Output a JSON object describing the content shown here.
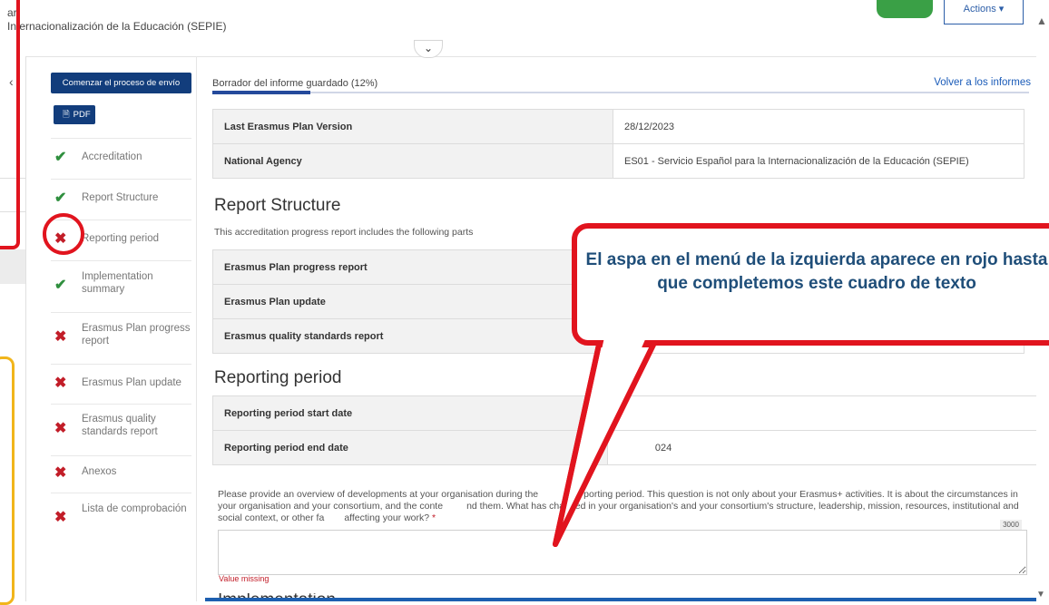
{
  "header": {
    "line1": "ar",
    "line2": "Internacionalización de la Educación (SEPIE)",
    "actions_label": "Actions ▾",
    "collapse_glyph": "⌄"
  },
  "sidebar": {
    "submit_button": "Comenzar el proceso de envío",
    "pdf_button": "PDF",
    "items": [
      {
        "label": "Accreditation",
        "status": "complete"
      },
      {
        "label": "Report Structure",
        "status": "complete"
      },
      {
        "label": "Reporting period",
        "status": "incomplete"
      },
      {
        "label": "Implementation summary",
        "status": "complete"
      },
      {
        "label": "Erasmus Plan progress report",
        "status": "incomplete"
      },
      {
        "label": "Erasmus Plan update",
        "status": "incomplete"
      },
      {
        "label": "Erasmus quality standards report",
        "status": "incomplete"
      },
      {
        "label": "Anexos",
        "status": "incomplete"
      },
      {
        "label": "Lista de comprobación",
        "status": "incomplete"
      }
    ],
    "icons": {
      "complete": "✔",
      "incomplete": "✖"
    }
  },
  "main": {
    "progress_label": "Borrador del informe guardado (12%)",
    "progress_percent": 12,
    "back_link": "Volver a los informes",
    "accreditation_rows": [
      {
        "key": "Last Erasmus Plan Version",
        "value": "28/12/2023"
      },
      {
        "key": "National Agency",
        "value": "ES01 - Servicio Español para la Internacionalización de la Educación (SEPIE)"
      }
    ],
    "report_structure": {
      "title": "Report Structure",
      "description": "This accreditation progress report includes the following parts",
      "rows": [
        {
          "key": "Erasmus Plan progress report",
          "value": ""
        },
        {
          "key": "Erasmus Plan update",
          "value": ""
        },
        {
          "key": "Erasmus quality standards report",
          "value": ""
        }
      ]
    },
    "reporting_period": {
      "title": "Reporting period",
      "rows": [
        {
          "key": "Reporting period start date",
          "value": ""
        },
        {
          "key": "Reporting period end date",
          "value": "024"
        }
      ],
      "question_a": "Please provide an overview of developments at your organisation during the",
      "question_b": "porting period. This question is not only about your Erasmus+ activities. It is about the circumstances in your organisation and your consortium, and the conte",
      "question_c": "nd them. What has changed in your organisation's and your consortium's structure, leadership, mission, resources, institutional and social context, or other fa",
      "question_d": "affecting your work?",
      "required_mark": "*",
      "char_limit": "3000",
      "answer_value": "",
      "validation_error": "Value missing"
    },
    "next_section_title": "Implementation"
  },
  "annotation": {
    "callout_text": "El aspa en el menú de la izquierda aparece en rojo hasta que completemos este cuadro de texto"
  },
  "colors": {
    "nav_button": "#123d7c",
    "check_green": "#2f8f3e",
    "cross_red": "#c21d28",
    "annotation_red": "#e1141e",
    "callout_text": "#1f4e79",
    "highlight_yellow": "#f1b51b"
  }
}
